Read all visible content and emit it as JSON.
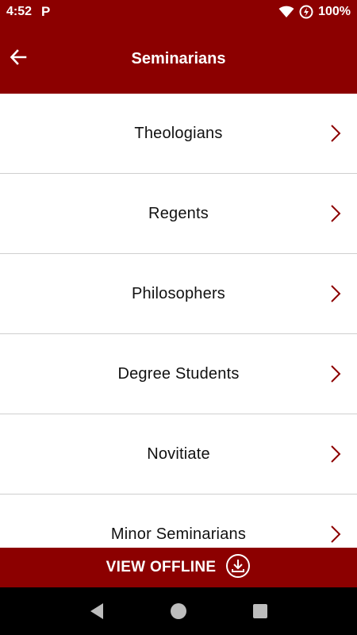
{
  "status_bar": {
    "time": "4:52",
    "app_indicator": "P",
    "battery": "100%",
    "icons": [
      "wifi-icon",
      "data-saver-icon"
    ]
  },
  "header": {
    "title": "Seminarians",
    "back_icon": "arrow-left-icon"
  },
  "list": {
    "items": [
      {
        "label": "Theologians"
      },
      {
        "label": "Regents"
      },
      {
        "label": "Philosophers"
      },
      {
        "label": "Degree Students"
      },
      {
        "label": "Novitiate"
      },
      {
        "label": "Minor Seminarians"
      }
    ],
    "chevron_icon": "chevron-right-icon"
  },
  "footer": {
    "offline_label": "VIEW OFFLINE",
    "offline_icon": "download-icon"
  },
  "nav": {
    "back": "nav-back-icon",
    "home": "nav-home-icon",
    "recents": "nav-recents-icon"
  },
  "colors": {
    "brand": "#8c0000",
    "chevron": "#8c0000",
    "divider": "#cfcfcf",
    "text": "#111111"
  }
}
